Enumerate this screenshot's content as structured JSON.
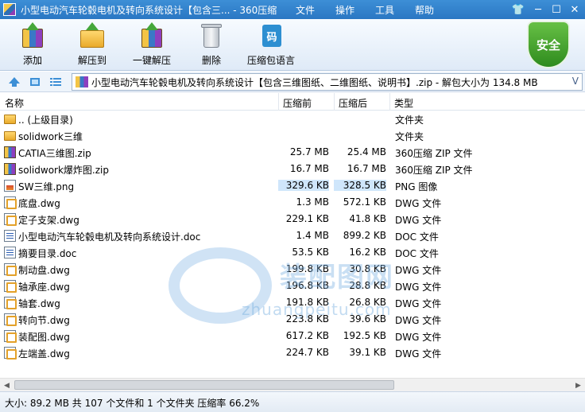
{
  "window": {
    "title": "小型电动汽车轮毂电机及转向系统设计【包含三... - 360压缩",
    "menu": [
      "文件",
      "操作",
      "工具",
      "帮助"
    ],
    "controls": {
      "skin": "👕",
      "min": "─",
      "max": "☐",
      "close": "✕"
    }
  },
  "toolbar": {
    "buttons": [
      "添加",
      "解压到",
      "一键解压",
      "删除",
      "压缩包语言"
    ],
    "lang_glyph": "码",
    "security_label": "安全"
  },
  "address": {
    "path": "小型电动汽车轮毂电机及转向系统设计【包含三维图纸、二维图纸、说明书】.zip - 解包大小为 134.8 MB",
    "dropdown": "V"
  },
  "columns": [
    "名称",
    "压缩前",
    "压缩后",
    "类型"
  ],
  "files": [
    {
      "name": ".. (上级目录)",
      "before": "",
      "after": "",
      "type": "文件夹",
      "icon": "folder"
    },
    {
      "name": "solidwork三维",
      "before": "",
      "after": "",
      "type": "文件夹",
      "icon": "folder"
    },
    {
      "name": "CATIA三维图.zip",
      "before": "25.7 MB",
      "after": "25.4 MB",
      "type": "360压缩 ZIP 文件",
      "icon": "zip"
    },
    {
      "name": "solidwork爆炸图.zip",
      "before": "16.7 MB",
      "after": "16.7 MB",
      "type": "360压缩 ZIP 文件",
      "icon": "zip"
    },
    {
      "name": "SW三维.png",
      "before": "329.6 KB",
      "after": "328.5 KB",
      "type": "PNG 图像",
      "icon": "png"
    },
    {
      "name": "底盘.dwg",
      "before": "1.3 MB",
      "after": "572.1 KB",
      "type": "DWG 文件",
      "icon": "dwg"
    },
    {
      "name": "定子支架.dwg",
      "before": "229.1 KB",
      "after": "41.8 KB",
      "type": "DWG 文件",
      "icon": "dwg"
    },
    {
      "name": "小型电动汽车轮毂电机及转向系统设计.doc",
      "before": "1.4 MB",
      "after": "899.2 KB",
      "type": "DOC 文件",
      "icon": "doc"
    },
    {
      "name": "摘要目录.doc",
      "before": "53.5 KB",
      "after": "16.2 KB",
      "type": "DOC 文件",
      "icon": "doc"
    },
    {
      "name": "制动盘.dwg",
      "before": "199.8 KB",
      "after": "30.8 KB",
      "type": "DWG 文件",
      "icon": "dwg"
    },
    {
      "name": "轴承座.dwg",
      "before": "196.8 KB",
      "after": "28.8 KB",
      "type": "DWG 文件",
      "icon": "dwg"
    },
    {
      "name": "轴套.dwg",
      "before": "191.8 KB",
      "after": "26.8 KB",
      "type": "DWG 文件",
      "icon": "dwg"
    },
    {
      "name": "转向节.dwg",
      "before": "223.8 KB",
      "after": "39.6 KB",
      "type": "DWG 文件",
      "icon": "dwg"
    },
    {
      "name": "装配图.dwg",
      "before": "617.2 KB",
      "after": "192.5 KB",
      "type": "DWG 文件",
      "icon": "dwg"
    },
    {
      "name": "左端盖.dwg",
      "before": "224.7 KB",
      "after": "39.1 KB",
      "type": "DWG 文件",
      "icon": "dwg"
    }
  ],
  "watermark": {
    "cn": "装配图网",
    "en": "zhuangpeitu.com"
  },
  "status": "大小: 89.2 MB 共 107 个文件和 1 个文件夹 压缩率 66.2%",
  "scroll": {
    "left": "◀",
    "right": "▶"
  }
}
